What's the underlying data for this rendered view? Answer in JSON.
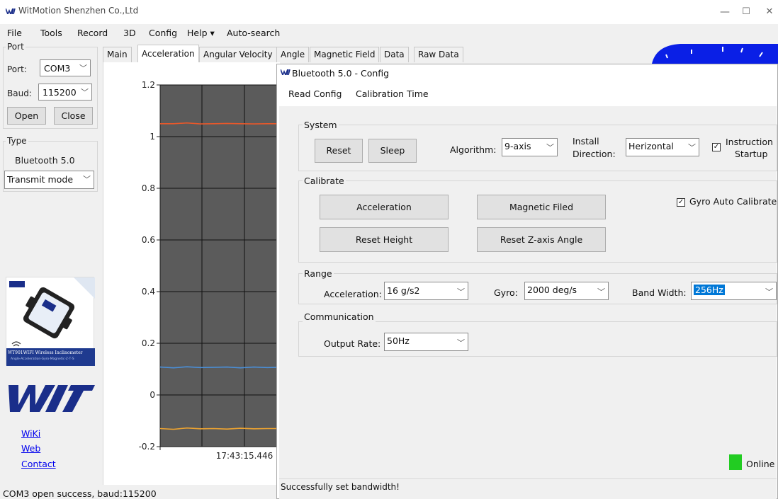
{
  "window": {
    "title": "WitMotion Shenzhen Co.,Ltd",
    "controls": {
      "minimize": "—",
      "maximize": "☐",
      "close": "✕"
    }
  },
  "menu": {
    "file": "File",
    "tools": "Tools",
    "record": "Record",
    "threed": "3D",
    "config": "Config",
    "help": "Help ▾",
    "autosearch": "Auto-search"
  },
  "port_panel": {
    "group": "Port",
    "port_label": "Port:",
    "port_value": "COM3",
    "baud_label": "Baud:",
    "baud_value": "115200",
    "open_button": "Open",
    "close_button": "Close"
  },
  "type_panel": {
    "group": "Type",
    "device": "Bluetooth 5.0",
    "mode_value": "Transmit mode"
  },
  "product_card": {
    "name": "WT901WIFI  Wireless Inclinometer",
    "sub": "Angle·Acceleration·Gyro·Magnetic·ℤ·T·S"
  },
  "links": {
    "wiki": "WiKi",
    "web": "Web",
    "contact": "Contact"
  },
  "tabs": [
    "Main",
    "Acceleration",
    "Angular Velocity",
    "Angle",
    "Magnetic Field",
    "Data",
    "Raw Data"
  ],
  "chart_data": {
    "type": "line",
    "title": "",
    "xlabel": "",
    "ylabel": "",
    "ylim": [
      -0.2,
      1.2
    ],
    "yticks": [
      "1.2",
      "1",
      "0.8",
      "0.6",
      "0.4",
      "0.2",
      "0",
      "-0.2"
    ],
    "x_tick_label": "17:43:15.446",
    "series": [
      {
        "color": "#e8582a",
        "values": [
          1.05,
          1.05,
          1.053,
          1.049,
          1.05,
          1.051,
          1.05,
          1.049,
          1.05,
          1.05
        ]
      },
      {
        "color": "#4a8fd8",
        "values": [
          0.108,
          0.105,
          0.109,
          0.106,
          0.107,
          0.108,
          0.105,
          0.108,
          0.106,
          0.107
        ]
      },
      {
        "color": "#f0a530",
        "values": [
          -0.13,
          -0.133,
          -0.128,
          -0.131,
          -0.13,
          -0.132,
          -0.129,
          -0.131,
          -0.13,
          -0.13
        ]
      }
    ]
  },
  "dialog": {
    "title": "Bluetooth 5.0 - Config",
    "menu_read": "Read Config",
    "menu_calib": "Calibration Time",
    "system": {
      "group": "System",
      "reset": "Reset",
      "sleep": "Sleep",
      "algorithm_label": "Algorithm:",
      "algorithm_value": "9-axis",
      "install_label_1": "Install",
      "install_label_2": "Direction:",
      "install_value": "Herizontal",
      "instruction_1": "Instruction",
      "instruction_2": "Startup"
    },
    "calibrate": {
      "group": "Calibrate",
      "acceleration": "Acceleration",
      "magnetic": "Magnetic Filed",
      "reset_height": "Reset Height",
      "reset_z": "Reset Z-axis Angle",
      "gyro_auto": "Gyro Auto Calibrate"
    },
    "range": {
      "group": "Range",
      "acc_label": "Acceleration:",
      "acc_value": "16 g/s2",
      "gyro_label": "Gyro:",
      "gyro_value": "2000 deg/s",
      "bw_label": "Band Width:",
      "bw_value": "256Hz"
    },
    "communication": {
      "group": "Communication",
      "rate_label": "Output Rate:",
      "rate_value": "50Hz"
    },
    "online": "Online",
    "status": "Successfully set bandwidth!"
  },
  "main_status": "COM3 open success, baud:115200",
  "colors": {
    "plot_bg": "#5b5b5b",
    "online": "#22cc22",
    "selection": "#0078d7",
    "gauge": "#0a1fe6"
  }
}
